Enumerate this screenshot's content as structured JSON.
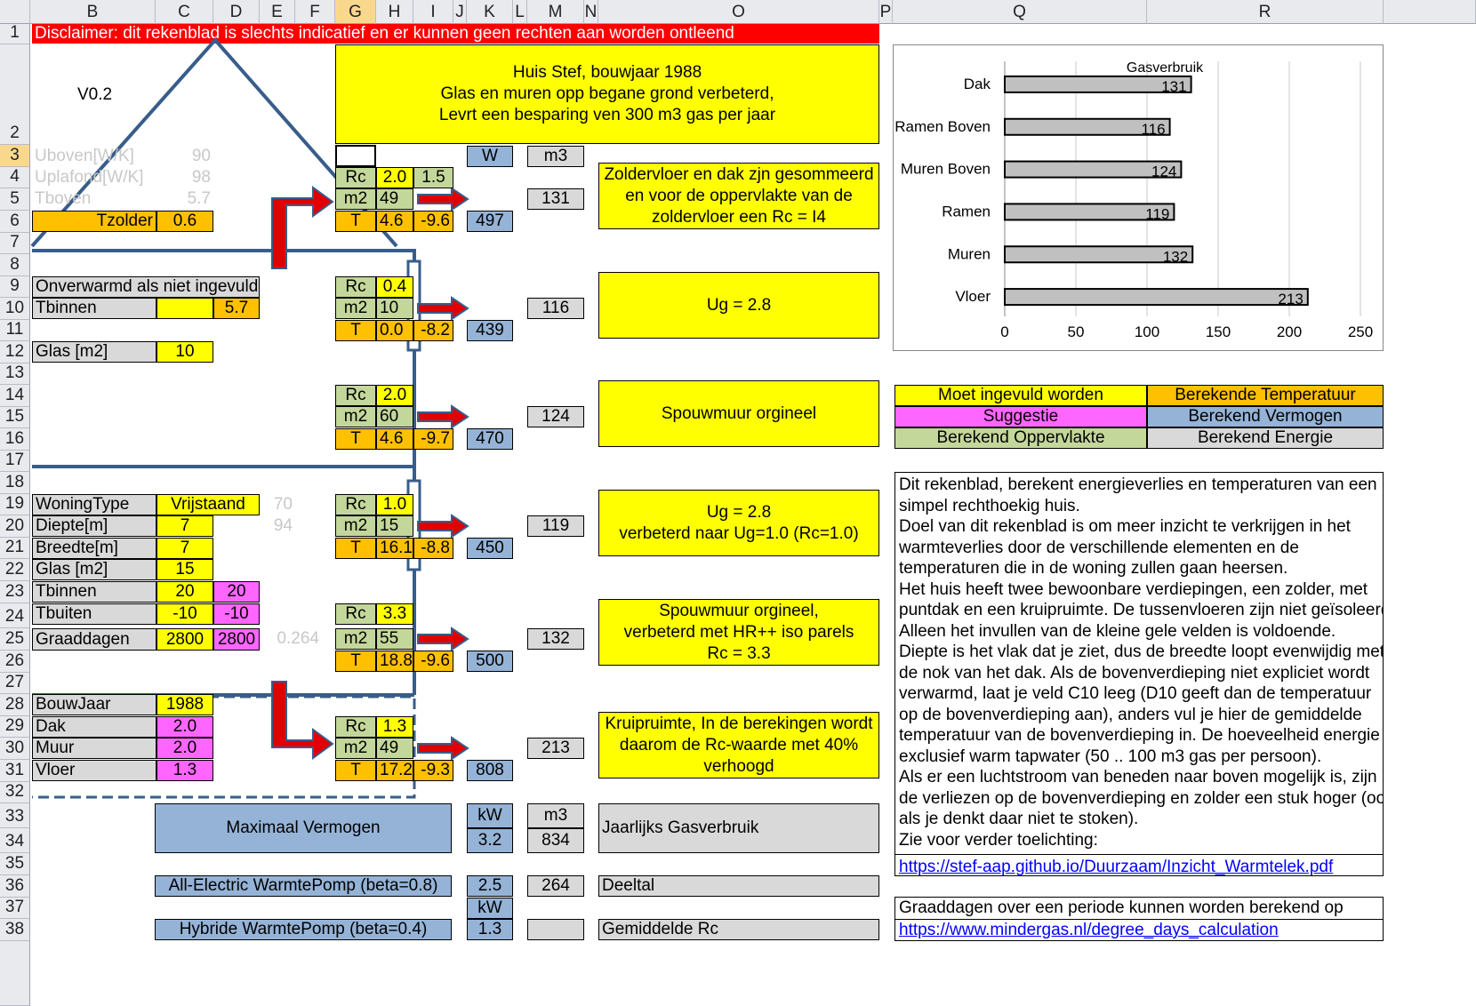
{
  "columns": [
    "B",
    "C",
    "D",
    "E",
    "F",
    "G",
    "H",
    "I",
    "J",
    "K",
    "L",
    "M",
    "N",
    "O",
    "P",
    "Q",
    "R"
  ],
  "rows": [
    "1",
    "2",
    "3",
    "4",
    "5",
    "6",
    "7",
    "8",
    "9",
    "10",
    "11",
    "12",
    "13",
    "14",
    "15",
    "16",
    "17",
    "18",
    "19",
    "20",
    "21",
    "22",
    "23",
    "24",
    "25",
    "26",
    "27",
    "28",
    "29",
    "30",
    "31",
    "32",
    "33",
    "34",
    "35",
    "36",
    "37",
    "38"
  ],
  "disclaimer": "Disclaimer: dit rekenblad is slechts indicatief en er kunnen geen rechten aan worden ontleend",
  "version": "V0.2",
  "title_box": {
    "line1": "Huis Stef, bouwjaar 1988",
    "line2": "Glas en muren opp begane grond verbeterd,",
    "line3": "Levrt een besparing ven 300 m3 gas per jaar"
  },
  "faint": {
    "uboven": "Uboven[W/K]",
    "uboven_val": "90",
    "uplafond": "Uplafond[W/K]",
    "uplafond_val": "98",
    "tboven": "Tboven",
    "tboven_val": "5.7",
    "n70": "70",
    "n94": "94",
    "n264": "0.264"
  },
  "units": {
    "w": "W",
    "m3": "m3",
    "kw": "kW"
  },
  "tzolder": {
    "label": "Tzolder",
    "value": "0.6"
  },
  "sections": {
    "roof": {
      "rc": "2.0",
      "rc2": "1.5",
      "m2": "49",
      "t": "4.6",
      "t2": "-9.6",
      "w": "497",
      "m3": "131",
      "note": "Zoldervloer en dak zjn gesommeerd en voor de oppervlakte van de zoldervloer een Rc = I4"
    },
    "win_up": {
      "rc": "0.4",
      "m2": "10",
      "t": "0.0",
      "t2": "-8.2",
      "w": "439",
      "m3": "116",
      "note": "Ug = 2.8"
    },
    "wall_up": {
      "rc": "2.0",
      "m2": "60",
      "t": "4.6",
      "t2": "-9.7",
      "w": "470",
      "m3": "124",
      "note": "Spouwmuur orgineel"
    },
    "win_dn": {
      "rc": "1.0",
      "m2": "15",
      "t": "16.1",
      "t2": "-8.8",
      "w": "450",
      "m3": "119",
      "note1": "Ug = 2.8",
      "note2": "verbeterd naar Ug=1.0 (Rc=1.0)"
    },
    "wall_dn": {
      "rc": "3.3",
      "m2": "55",
      "t": "18.8",
      "t2": "-9.6",
      "w": "500",
      "m3": "132",
      "note1": "Spouwmuur orgineel,",
      "note2": "verbeterd met HR++ iso parels",
      "note3": "Rc = 3.3"
    },
    "floor": {
      "rc": "1.3",
      "m2": "49",
      "t": "17.2",
      "t2": "-9.3",
      "w": "808",
      "m3": "213",
      "note": "Kruipruimte, In de berekingen wordt daarom de Rc-waarde met 40% verhoogd"
    }
  },
  "labels": {
    "rc": "Rc",
    "m2": "m2",
    "t": "T"
  },
  "upper": {
    "onverwarmd": "Onverwarmd als niet ingevuld",
    "tbinnen": "Tbinnen",
    "tbinnen_val": "5.7",
    "glas": "Glas [m2]",
    "glas_val": "10"
  },
  "lower": [
    {
      "label": "WoningType",
      "value": "Vrijstaand"
    },
    {
      "label": "Diepte[m]",
      "value": "7"
    },
    {
      "label": "Breedte[m]",
      "value": "7"
    },
    {
      "label": "Glas [m2]",
      "value": "15"
    },
    {
      "label": "Tbinnen",
      "value": "20",
      "sugg": "20"
    },
    {
      "label": "Tbuiten",
      "value": "-10",
      "sugg": "-10"
    },
    {
      "label": "Graaddagen",
      "value": "2800",
      "sugg": "2800"
    }
  ],
  "build": [
    {
      "label": "BouwJaar",
      "value": "1988"
    },
    {
      "label": "Dak",
      "value": "2.0"
    },
    {
      "label": "Muur",
      "value": "2.0"
    },
    {
      "label": "Vloer",
      "value": "1.3"
    }
  ],
  "totals": {
    "max_label": "Maximaal Vermogen",
    "kw_val": "3.2",
    "m3_val": "834",
    "jaar_label": "Jaarlijks Gasverbruik",
    "ae_label": "All-Electric WarmtePomp (beta=0.8)",
    "ae_kw": "2.5",
    "ae_m3": "264",
    "deeltal": "Deeltal",
    "hyb_label": "Hybride WarmtePomp (beta=0.4)",
    "hyb_kw": "1.3",
    "gem_rc": "Gemiddelde Rc"
  },
  "legend": [
    {
      "label": "Moet ingevuld worden",
      "color": "#ffff00"
    },
    {
      "label": "Berekende Temperatuur",
      "color": "#ffc000"
    },
    {
      "label": "Suggestie",
      "color": "#ff66ff"
    },
    {
      "label": "Berekend Vermogen",
      "color": "#95b3d7"
    },
    {
      "label": "Berekend Oppervlakte",
      "color": "#c4d79b"
    },
    {
      "label": "Berekend Energie",
      "color": "#d9d9d9"
    }
  ],
  "info_lines": [
    "Dit rekenblad, berekent energieverlies en temperaturen van een",
    "simpel rechthoekig huis.",
    "Doel van dit rekenblad is om meer inzicht te verkrijgen in het",
    "warmteverlies door de verschillende elementen en de",
    "temperaturen die in de woning zullen gaan heersen.",
    "Het huis heeft twee bewoonbare verdiepingen, een zolder, met",
    "puntdak en een kruipruimte. De tussenvloeren zijn niet geïsoleerd.",
    "Alleen het invullen van de kleine gele velden is voldoende.",
    "Diepte is het vlak dat je ziet, dus de breedte loopt evenwijdig met",
    "de nok van het dak. Als de bovenverdieping niet expliciet wordt",
    "verwarmd, laat je veld C10 leeg (D10 geeft dan de temperatuur",
    "op de bovenverdieping aan), anders vul je hier de gemiddelde",
    "temperatuur van de bovenverdieping in. De hoeveelheid energie is",
    "exclusief warm tapwater (50 .. 100 m3 gas per persoon).",
    "Als er een luchtstroom van beneden naar boven mogelijk is, zijn",
    "de verliezen op de bovenverdieping en zolder een stuk hoger (ook",
    "als je denkt daar niet te stoken).",
    "Zie voor verder toelichting:"
  ],
  "link1": "https://stef-aap.github.io/Duurzaam/Inzicht_Warmtelek.pdf",
  "graad_text": "Graaddagen over een periode kunnen worden berekend op",
  "link2": "https://www.mindergas.nl/degree_days_calculation",
  "chart_data": {
    "type": "bar",
    "orientation": "horizontal",
    "title": "Gasverbruik",
    "categories": [
      "Dak",
      "Ramen Boven",
      "Muren Boven",
      "Ramen",
      "Muren",
      "Vloer"
    ],
    "values": [
      131,
      116,
      124,
      119,
      132,
      213
    ],
    "xlim": [
      0,
      250
    ],
    "xticks": [
      0,
      50,
      100,
      150,
      200,
      250
    ],
    "grid": true,
    "bar_color": "#c0c0c0"
  }
}
